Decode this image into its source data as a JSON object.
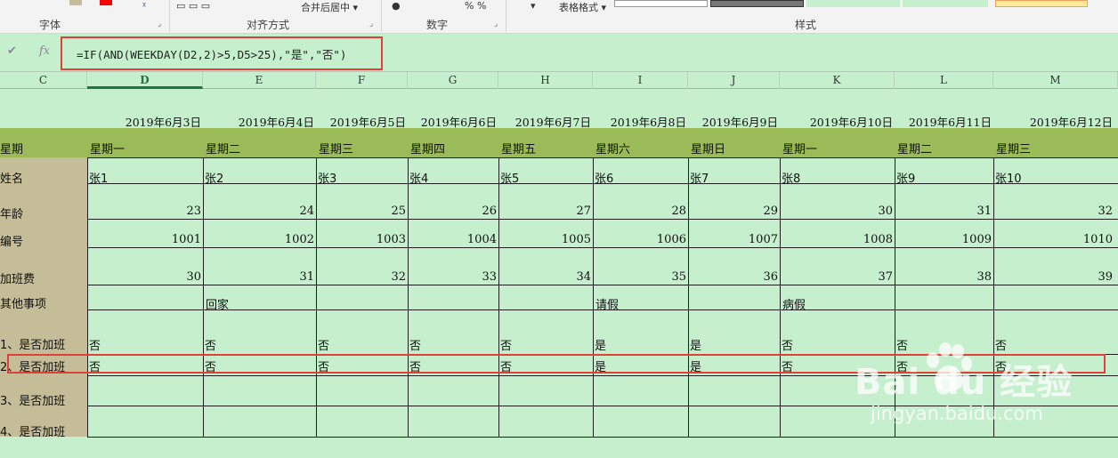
{
  "ribbon": {
    "groups": {
      "font": "字体",
      "alignment": "对齐方式",
      "number": "数字",
      "styles": "样式"
    },
    "table_format_label": "表格格式",
    "merge_label": "合并后居中",
    "percent_label": "%"
  },
  "formula_bar": {
    "cancel_icon": "✔",
    "fx_icon": "fx",
    "formula": "=IF(AND(WEEKDAY(D2,2)>5,D5>25),\"是\",\"否\")"
  },
  "columns": [
    "C",
    "D",
    "E",
    "F",
    "G",
    "H",
    "I",
    "J",
    "K",
    "L",
    "M"
  ],
  "active_column": "D",
  "dates": [
    "2019年6月3日",
    "2019年6月4日",
    "2019年6月5日",
    "2019年6月6日",
    "2019年6月7日",
    "2019年6月8日",
    "2019年6月9日",
    "2019年6月10日",
    "2019年6月11日",
    "2019年6月12日"
  ],
  "row_labels": {
    "weekday": "星期",
    "name": "姓名",
    "age": "年龄",
    "id": "编号",
    "overtime_pay": "加班费",
    "other": "其他事项",
    "q1": "1、是否加班",
    "q2": "2、是否加班",
    "q3": "3、是否加班",
    "q4": "4、是否加班"
  },
  "weekdays": [
    "星期一",
    "星期二",
    "星期三",
    "星期四",
    "星期五",
    "星期六",
    "星期日",
    "星期一",
    "星期二",
    "星期三"
  ],
  "names": [
    "张1",
    "张2",
    "张3",
    "张4",
    "张5",
    "张6",
    "张7",
    "张8",
    "张9",
    "张10"
  ],
  "ages": [
    "23",
    "24",
    "25",
    "26",
    "27",
    "28",
    "29",
    "30",
    "31",
    "32"
  ],
  "ids": [
    "1001",
    "1002",
    "1003",
    "1004",
    "1005",
    "1006",
    "1007",
    "1008",
    "1009",
    "1010"
  ],
  "overtime_pay": [
    "30",
    "31",
    "32",
    "33",
    "34",
    "35",
    "36",
    "37",
    "38",
    "39"
  ],
  "other": [
    "",
    "回家",
    "",
    "",
    "",
    "请假",
    "",
    "病假",
    "",
    ""
  ],
  "overtime_1": [
    "否",
    "否",
    "否",
    "否",
    "否",
    "是",
    "是",
    "否",
    "否",
    "否"
  ],
  "overtime_2": [
    "否",
    "否",
    "否",
    "否",
    "否",
    "是",
    "是",
    "否",
    "否",
    "否"
  ],
  "watermark": {
    "logo": "Bai du 经验",
    "url": "jingyan.baidu.com"
  },
  "colors": {
    "cell_bg": "#c6efce",
    "weekday_band": "#9bbb59",
    "label_column": "#c4bd97",
    "highlight_box": "#e0403a"
  }
}
